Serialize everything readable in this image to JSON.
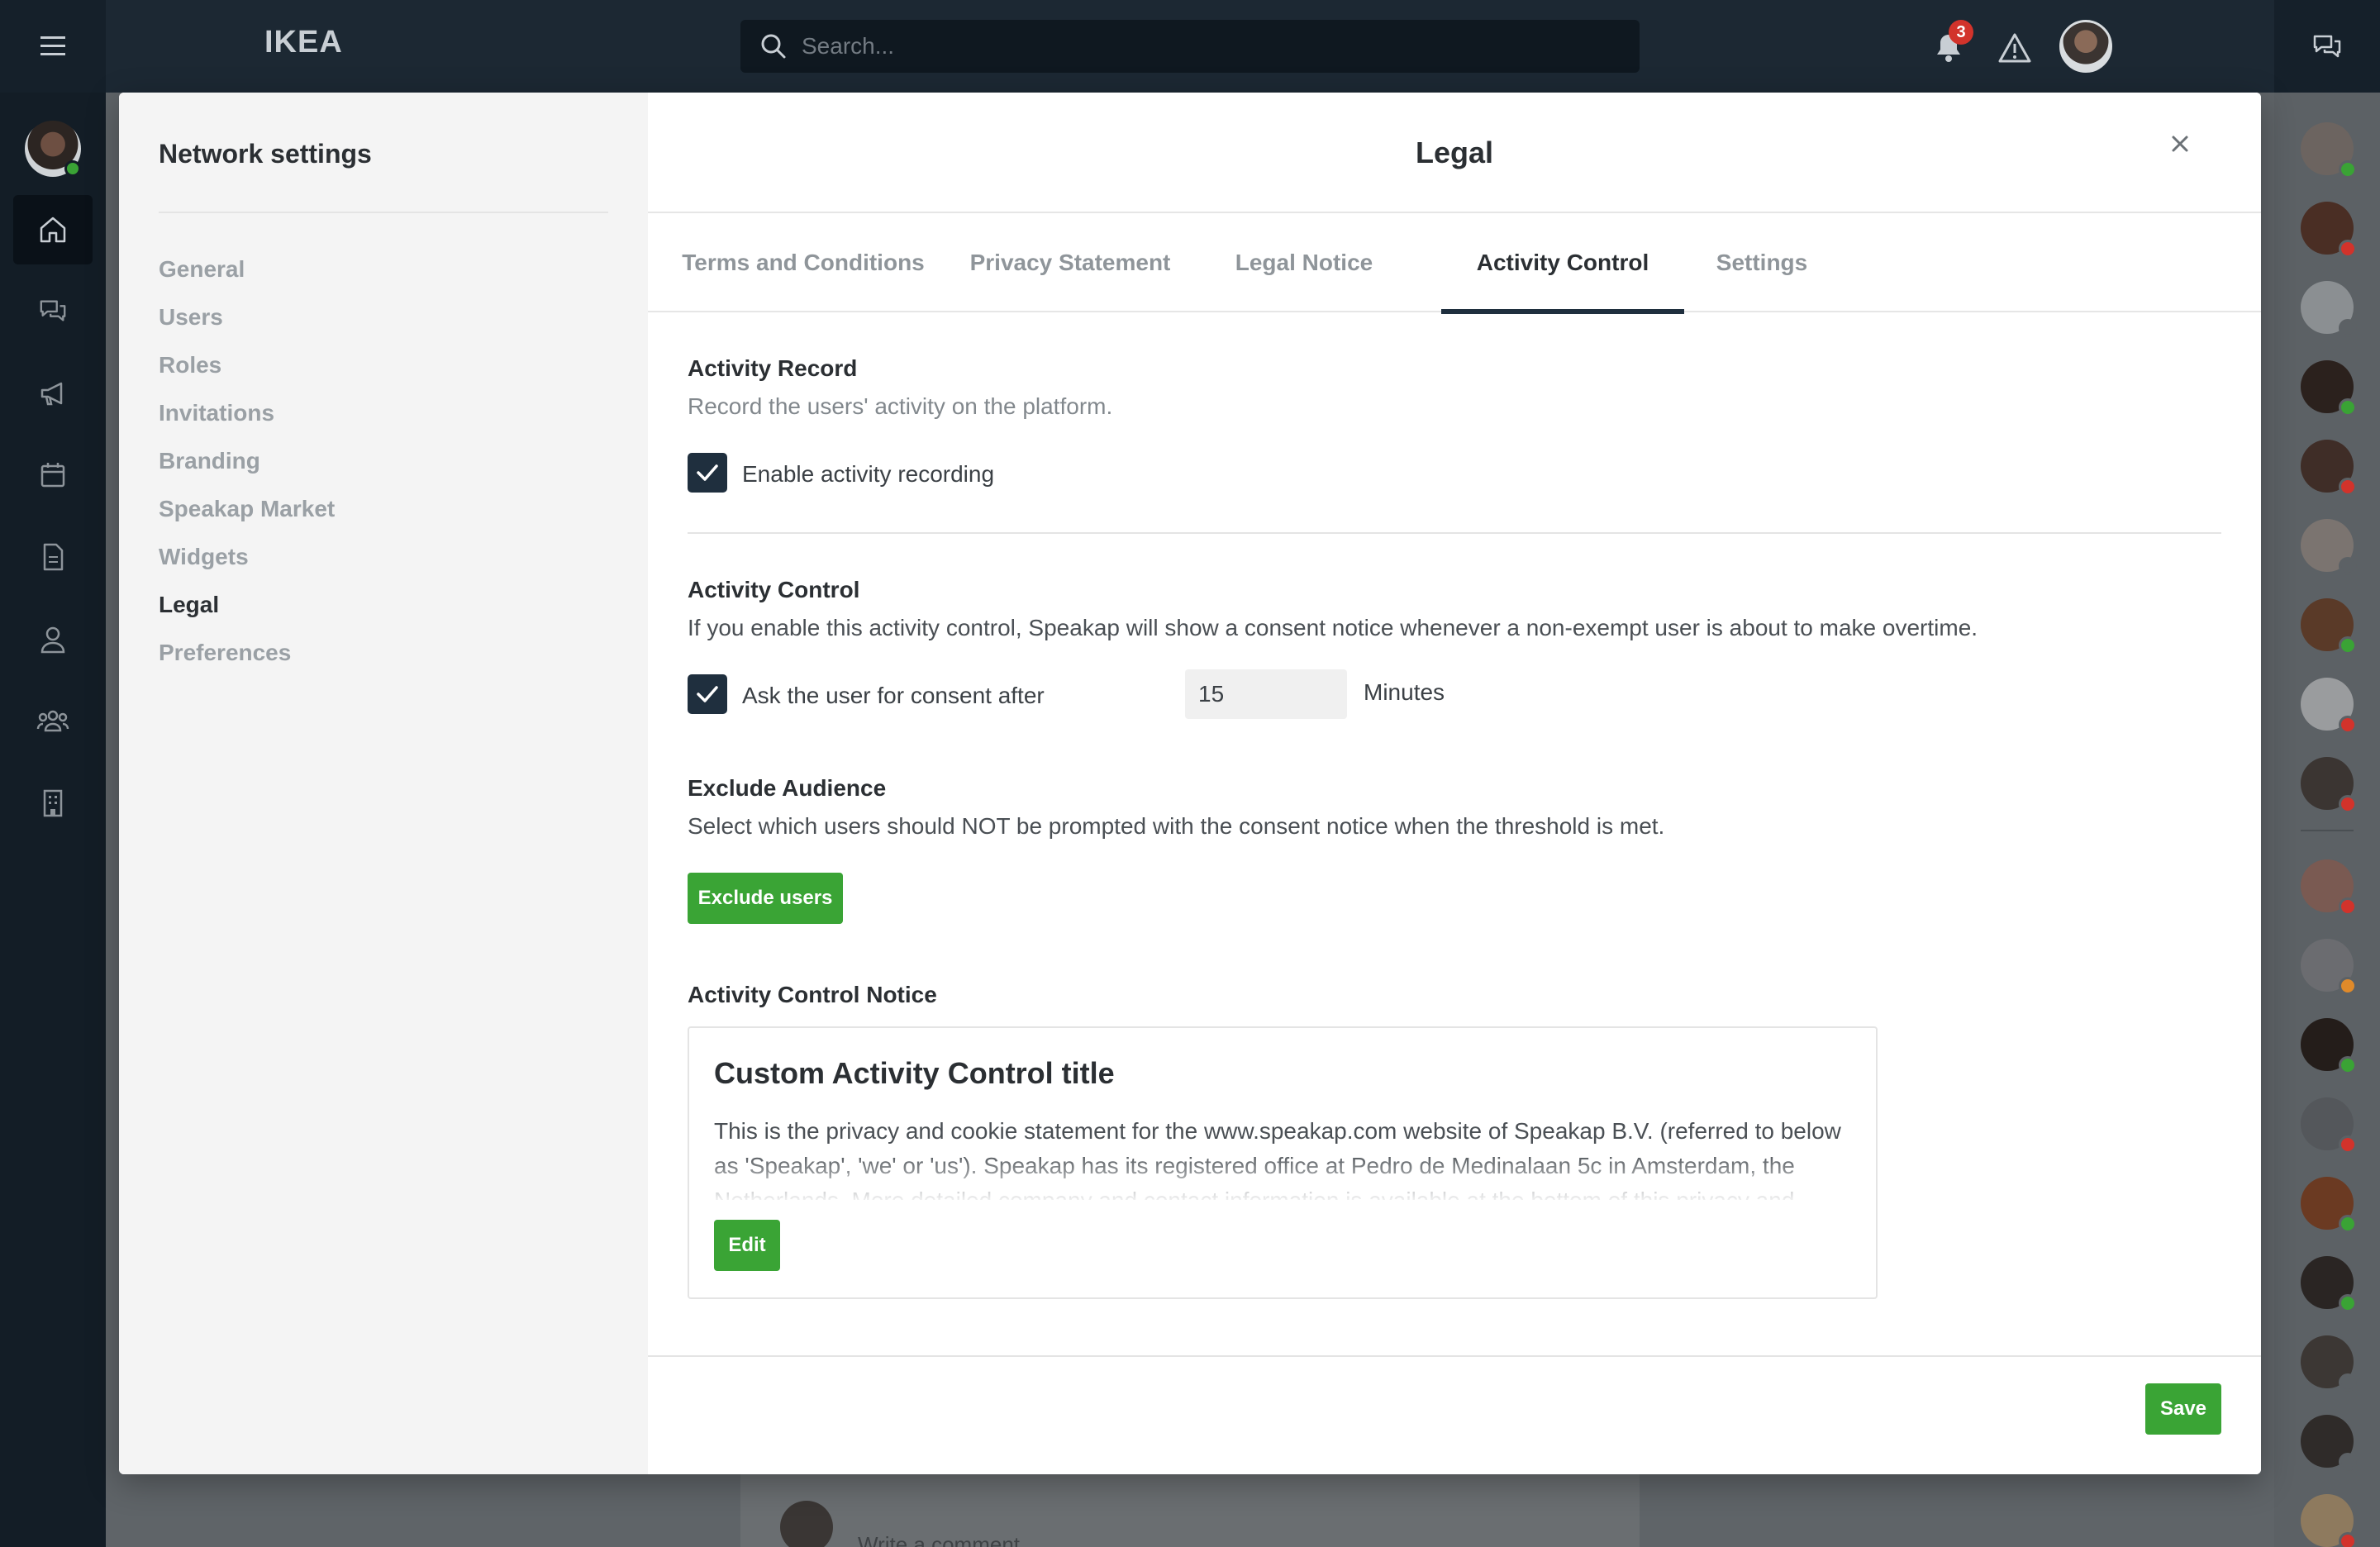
{
  "topbar": {
    "brand": "IKEA",
    "search_placeholder": "Search...",
    "notification_count": "3"
  },
  "feed": {
    "comment_placeholder": "Write a comment..."
  },
  "sidebar": {
    "title": "Network settings",
    "items": [
      {
        "label": "General",
        "active": false
      },
      {
        "label": "Users",
        "active": false
      },
      {
        "label": "Roles",
        "active": false
      },
      {
        "label": "Invitations",
        "active": false
      },
      {
        "label": "Branding",
        "active": false
      },
      {
        "label": "Speakap Market",
        "active": false
      },
      {
        "label": "Widgets",
        "active": false
      },
      {
        "label": "Legal",
        "active": true
      },
      {
        "label": "Preferences",
        "active": false
      }
    ]
  },
  "main": {
    "title": "Legal",
    "tabs": [
      {
        "label": "Terms and Conditions",
        "active": false
      },
      {
        "label": "Privacy Statement",
        "active": false
      },
      {
        "label": "Legal Notice",
        "active": false
      },
      {
        "label": "Activity Control",
        "active": true
      },
      {
        "label": "Settings",
        "active": false
      }
    ],
    "activity_record": {
      "title": "Activity Record",
      "description": "Record the users' activity on the platform.",
      "checkbox_label": "Enable activity recording",
      "checked": true
    },
    "activity_control": {
      "title": "Activity Control",
      "description": "If you enable this activity control, Speakap will show a consent notice whenever a non-exempt user is about to make overtime.",
      "checkbox_label": "Ask the user for consent after",
      "checked": true,
      "minutes_value": "15",
      "minutes_unit": "Minutes"
    },
    "exclude_audience": {
      "title": "Exclude Audience",
      "description": "Select which users should NOT be prompted with the consent notice when the threshold is met.",
      "button_label": "Exclude users"
    },
    "notice": {
      "title": "Activity Control Notice",
      "card_title": "Custom Activity Control title",
      "card_body": "This is the privacy and cookie statement for the www.speakap.com website of Speakap B.V. (referred to below as 'Speakap', 'we' or 'us'). Speakap has its registered office at Pedro de Medinalaan 5c in Amsterdam, the Netherlands. More detailed company and contact information is available at the bottom of this privacy and",
      "edit_label": "Edit"
    },
    "save_label": "Save"
  },
  "colors": {
    "primary_dark": "#1f2f3e",
    "accent_green": "#3aa435",
    "badge_red": "#d2332b"
  }
}
